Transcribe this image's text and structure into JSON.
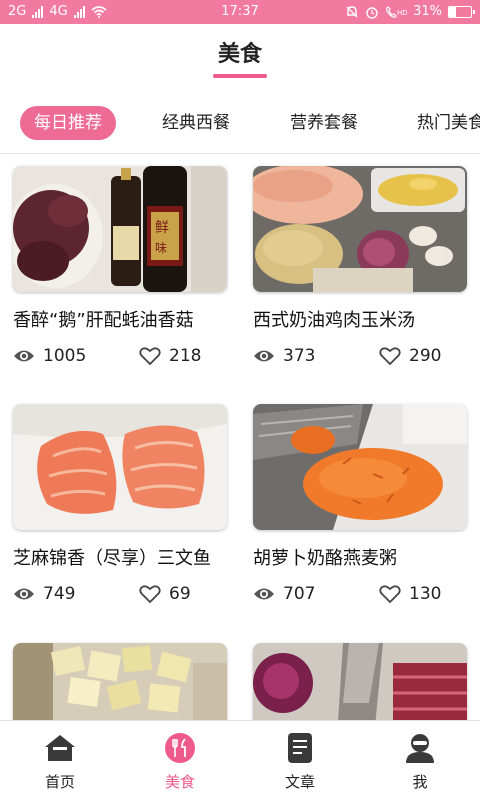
{
  "status_bar": {
    "time": "17:37",
    "battery": "31%",
    "battery_level": 0.31,
    "network_labels": [
      "2G",
      "4G"
    ]
  },
  "header": {
    "title": "美食"
  },
  "tabs": [
    {
      "label": "每日推荐",
      "active": true
    },
    {
      "label": "经典西餐",
      "active": false
    },
    {
      "label": "营养套餐",
      "active": false
    },
    {
      "label": "热门美食",
      "active": false
    }
  ],
  "recipes": [
    {
      "title": "香醉“鹅”肝配蚝油香菇",
      "views": "1005",
      "likes": "218",
      "image": "liver-and-oyster-sauce-photo"
    },
    {
      "title": "西式奶油鸡肉玉米汤",
      "views": "373",
      "likes": "290",
      "image": "chicken-potato-corn-photo"
    },
    {
      "title": "芝麻锦香（尽享）三文鱼",
      "views": "749",
      "likes": "69",
      "image": "salmon-fillets-photo"
    },
    {
      "title": "胡萝卜奶酪燕麦粥",
      "views": "707",
      "likes": "130",
      "image": "grated-carrot-photo"
    },
    {
      "title": "",
      "views": "",
      "likes": "",
      "image": "diced-potato-photo"
    },
    {
      "title": "",
      "views": "",
      "likes": "",
      "image": "onion-and-bacon-photo"
    }
  ],
  "bottom_nav": [
    {
      "label": "首页",
      "icon": "home-icon",
      "active": false
    },
    {
      "label": "美食",
      "icon": "fork-knife-icon",
      "active": true
    },
    {
      "label": "文章",
      "icon": "article-icon",
      "active": false
    },
    {
      "label": "我",
      "icon": "user-icon",
      "active": false
    }
  ],
  "colors": {
    "accent": "#ee5a8c",
    "status_bar": "#f27aa1"
  }
}
